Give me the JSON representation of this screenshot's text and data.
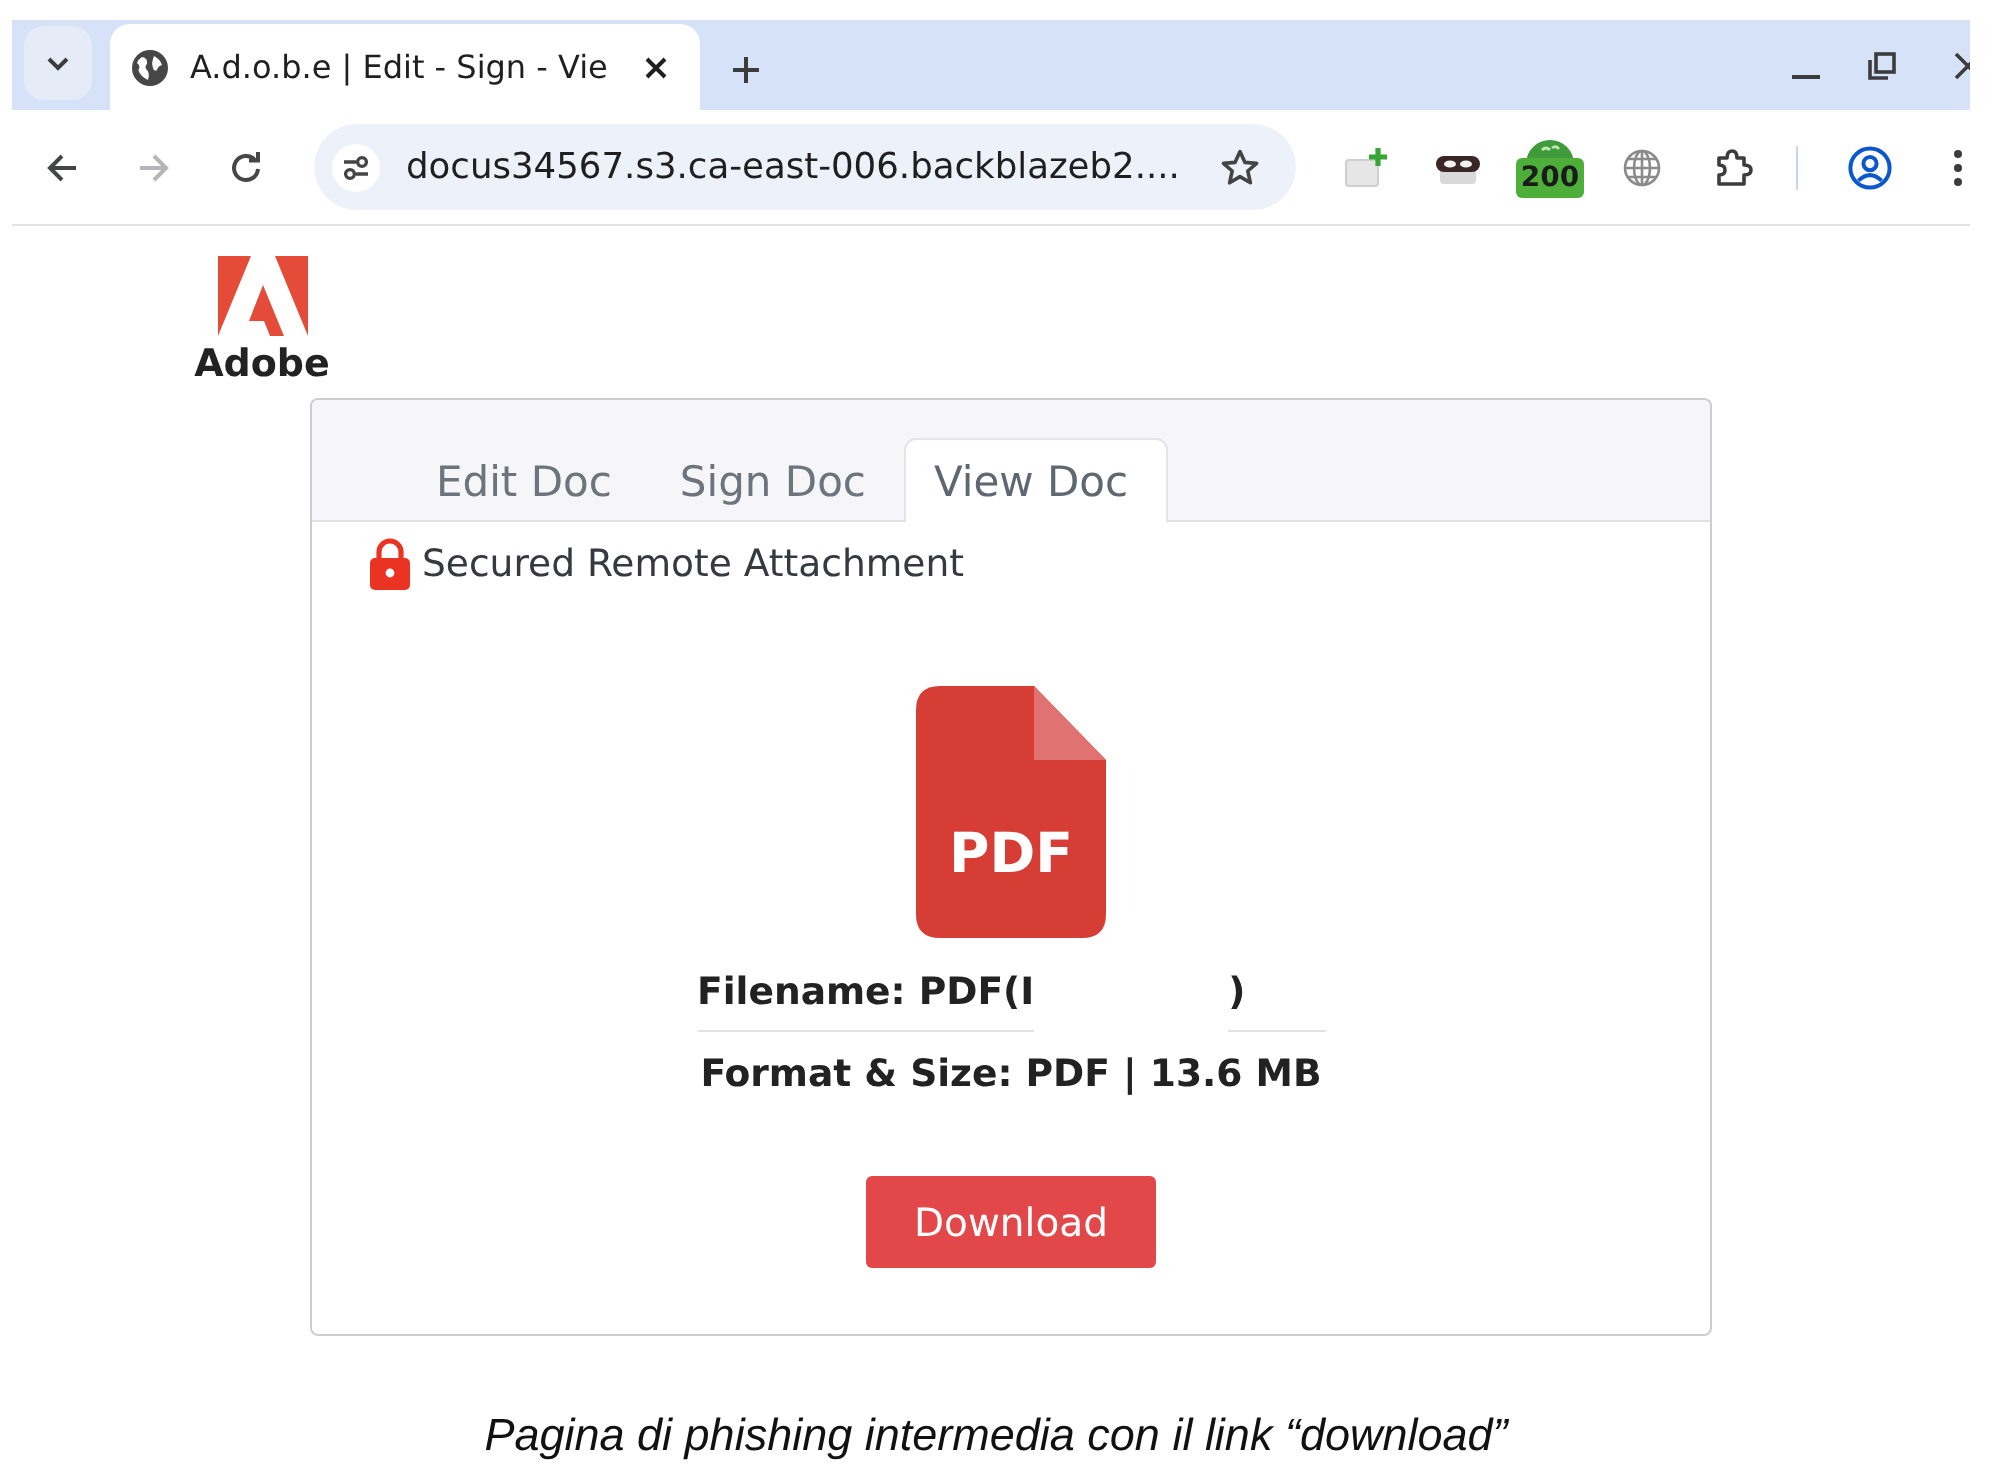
{
  "browser": {
    "tabs": [
      {
        "title": "A.d.o.b.e | Edit - Sign - Vie",
        "selected": true
      }
    ],
    "nav_buttons": [
      {
        "kind": "back",
        "disabled": false
      },
      {
        "kind": "forward",
        "disabled": true
      },
      {
        "kind": "reload",
        "disabled": false
      }
    ],
    "address_bar": {
      "url": "docus34567.s3.ca-east-006.backblazeb2...."
    },
    "extension_badge": "200"
  },
  "page": {
    "logo": {
      "text": "Adobe"
    },
    "card": {
      "tabs": [
        {
          "label": "Edit Doc",
          "selected": false
        },
        {
          "label": "Sign Doc",
          "selected": false
        },
        {
          "label": "View Doc",
          "selected": true
        }
      ],
      "notice": "Secured Remote Attachment",
      "file_icon": {
        "label": "PDF"
      },
      "filename": {
        "start": "Filename: PDF(I",
        "end": ")"
      },
      "format_size": "Format & Size: PDF | 13.6 MB",
      "download_button": "Download"
    }
  },
  "caption": "Pagina di phishing intermedia con il link “download”"
}
